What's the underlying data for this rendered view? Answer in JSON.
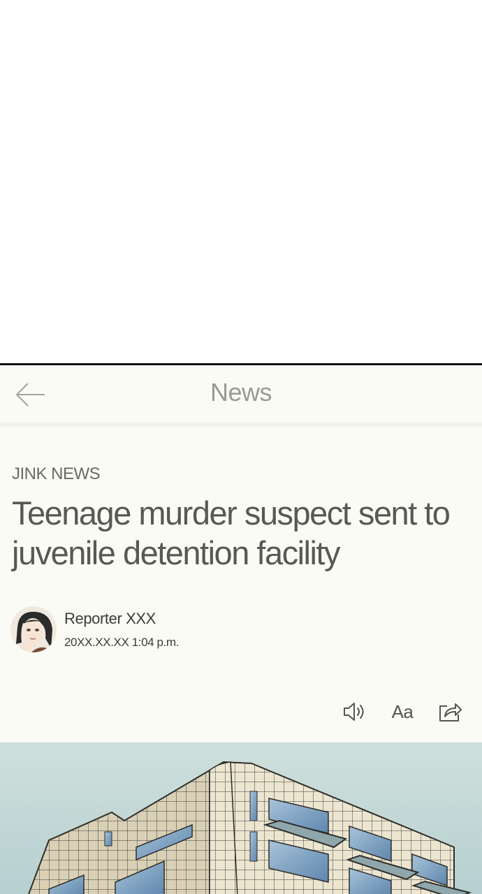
{
  "header": {
    "title": "News",
    "back_icon": "arrow-left-icon"
  },
  "article": {
    "source": "JINK NEWS",
    "headline": "Teenage murder suspect sent to juvenile detention facility",
    "reporter": "Reporter XXX",
    "timestamp": "20XX.XX.XX 1:04 p.m."
  },
  "toolbar": {
    "speaker_icon": "speaker-icon",
    "font_size_label": "Aa",
    "share_icon": "share-icon"
  },
  "colors": {
    "screen_background": "#fbfbf5",
    "title_gray": "#9a9a94",
    "headline_text": "#585854",
    "sky": "#cfe0dc",
    "building": "#ece5d0"
  }
}
